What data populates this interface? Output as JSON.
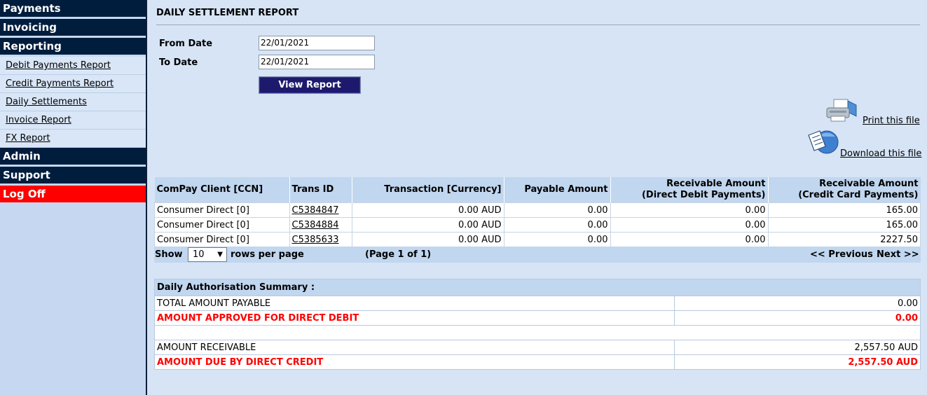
{
  "sidebar": {
    "payments": "Payments",
    "invoicing": "Invoicing",
    "reporting": "Reporting",
    "reporting_items": [
      "Debit Payments Report",
      "Credit Payments Report",
      "Daily Settlements",
      "Invoice Report",
      "FX Report"
    ],
    "admin": "Admin",
    "support": "Support",
    "logoff": "Log Off"
  },
  "page": {
    "title": "DAILY SETTLEMENT REPORT",
    "from_label": "From Date",
    "from_value": "22/01/2021",
    "to_label": "To Date",
    "to_value": "22/01/2021",
    "view_button": "View Report",
    "print_link": "Print this file",
    "download_link": "Download this file"
  },
  "table": {
    "headers": {
      "client": "ComPay Client [CCN]",
      "trans_id": "Trans ID",
      "transaction": "Transaction [Currency]",
      "payable": "Payable Amount",
      "recv_dd_1": "Receivable Amount",
      "recv_dd_2": "(Direct Debit Payments)",
      "recv_cc_1": "Receivable Amount",
      "recv_cc_2": "(Credit Card Payments)"
    },
    "rows": [
      {
        "client": "Consumer Direct [0]",
        "trans_id": "C5384847",
        "transaction": "0.00 AUD",
        "payable": "0.00",
        "recv_dd": "0.00",
        "recv_cc": "165.00"
      },
      {
        "client": "Consumer Direct [0]",
        "trans_id": "C5384884",
        "transaction": "0.00 AUD",
        "payable": "0.00",
        "recv_dd": "0.00",
        "recv_cc": "165.00"
      },
      {
        "client": "Consumer Direct [0]",
        "trans_id": "C5385633",
        "transaction": "0.00 AUD",
        "payable": "0.00",
        "recv_dd": "0.00",
        "recv_cc": "2227.50"
      }
    ]
  },
  "pager": {
    "show": "Show",
    "rows_value": "10",
    "rows_per_page": "rows per page",
    "page_info": "(Page 1 of 1)",
    "previous": "<< Previous",
    "next": "Next >>"
  },
  "summary": {
    "heading": "Daily Authorisation Summary :",
    "total_payable_label": "TOTAL AMOUNT PAYABLE",
    "total_payable_value": "0.00",
    "approved_dd_label": "AMOUNT APPROVED FOR DIRECT DEBIT",
    "approved_dd_value": "0.00",
    "receivable_label": "AMOUNT RECEIVABLE",
    "receivable_value": "2,557.50 AUD",
    "due_dc_label": "AMOUNT DUE BY DIRECT CREDIT",
    "due_dc_value": "2,557.50 AUD"
  },
  "colors": {
    "nav_head": "#001d3d",
    "logoff": "#ff0000",
    "button": "#1d1a6e",
    "highlight_red": "#ff0000"
  },
  "icons": [
    "printer-icon",
    "download-icon",
    "chevron-down-icon"
  ]
}
